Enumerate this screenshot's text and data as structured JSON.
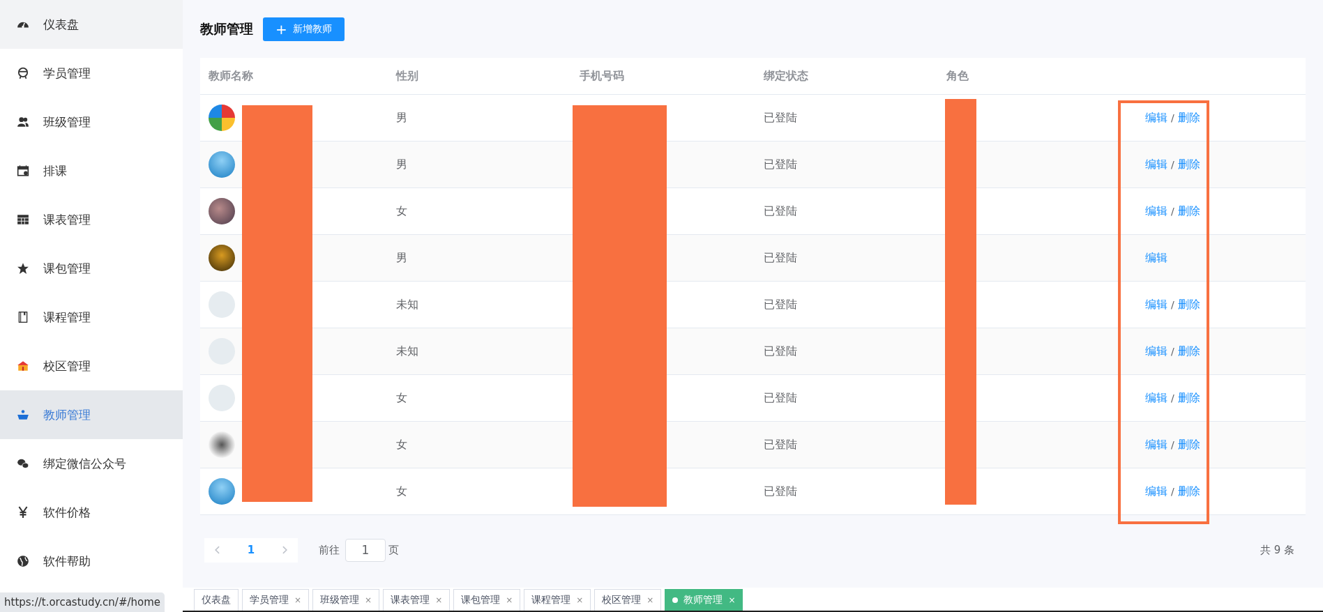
{
  "sidebar": {
    "items": [
      {
        "label": "仪表盘",
        "selected": false,
        "hovered": true
      },
      {
        "label": "学员管理",
        "selected": false,
        "hovered": false
      },
      {
        "label": "班级管理",
        "selected": false,
        "hovered": false
      },
      {
        "label": "排课",
        "selected": false,
        "hovered": false
      },
      {
        "label": "课表管理",
        "selected": false,
        "hovered": false
      },
      {
        "label": "课包管理",
        "selected": false,
        "hovered": false
      },
      {
        "label": "课程管理",
        "selected": false,
        "hovered": false
      },
      {
        "label": "校区管理",
        "selected": false,
        "hovered": false
      },
      {
        "label": "教师管理",
        "selected": true,
        "hovered": false
      },
      {
        "label": "绑定微信公众号",
        "selected": false,
        "hovered": false
      },
      {
        "label": "软件价格",
        "selected": false,
        "hovered": false
      },
      {
        "label": "软件帮助",
        "selected": false,
        "hovered": false
      }
    ]
  },
  "status_url": "https://t.orcastudy.cn/#/home",
  "header": {
    "title": "教师管理",
    "add_button": {
      "icon": "+",
      "label": "新增教师"
    }
  },
  "table": {
    "columns": [
      "教师名称",
      "性别",
      "手机号码",
      "绑定状态",
      "角色"
    ],
    "rows": [
      {
        "gender": "男",
        "status": "已登陆",
        "actions": [
          "编辑",
          "删除"
        ],
        "separator": "/"
      },
      {
        "gender": "男",
        "status": "已登陆",
        "actions": [
          "编辑",
          "删除"
        ],
        "separator": "/"
      },
      {
        "gender": "女",
        "status": "已登陆",
        "actions": [
          "编辑",
          "删除"
        ],
        "separator": "/"
      },
      {
        "gender": "男",
        "status": "已登陆",
        "actions": [
          "编辑"
        ]
      },
      {
        "gender": "未知",
        "status": "已登陆",
        "actions": [
          "编辑",
          "删除"
        ],
        "separator": "/"
      },
      {
        "gender": "未知",
        "status": "已登陆",
        "actions": [
          "编辑",
          "删除"
        ],
        "separator": "/"
      },
      {
        "gender": "女",
        "status": "已登陆",
        "actions": [
          "编辑",
          "删除"
        ],
        "separator": "/"
      },
      {
        "gender": "女",
        "status": "已登陆",
        "actions": [
          "编辑",
          "删除"
        ],
        "separator": "/"
      },
      {
        "gender": "女",
        "status": "已登陆",
        "actions": [
          "编辑",
          "删除"
        ],
        "separator": "/"
      }
    ]
  },
  "pagination": {
    "pages": [
      {
        "label": "1",
        "selected": true
      }
    ],
    "goto_label": "前往",
    "goto_value": "1",
    "page_unit": "页",
    "total": "共 9 条"
  },
  "tabs": [
    {
      "label": "仪表盘",
      "closable": false,
      "selected": false
    },
    {
      "label": "学员管理",
      "closable": true,
      "selected": false,
      "close": "×"
    },
    {
      "label": "班级管理",
      "closable": true,
      "selected": false,
      "close": "×"
    },
    {
      "label": "课表管理",
      "closable": true,
      "selected": false,
      "close": "×"
    },
    {
      "label": "课包管理",
      "closable": true,
      "selected": false,
      "close": "×"
    },
    {
      "label": "课程管理",
      "closable": true,
      "selected": false,
      "close": "×"
    },
    {
      "label": "校区管理",
      "closable": true,
      "selected": false,
      "close": "×"
    },
    {
      "label": "教师管理",
      "closable": true,
      "selected": true,
      "close": "×"
    }
  ]
}
